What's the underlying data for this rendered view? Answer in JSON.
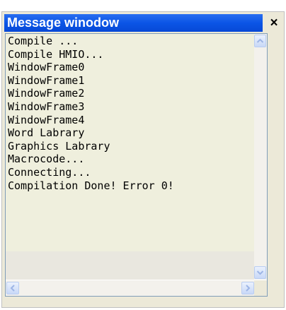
{
  "window": {
    "title": "Message winodow",
    "close_label": "×"
  },
  "messages": [
    "Compile ...",
    "Compile HMIO...",
    "WindowFrame0",
    "WindowFrame1",
    "WindowFrame2",
    "WindowFrame3",
    "WindowFrame4",
    "Word Labrary",
    "Graphics Labrary",
    "Macrocode...",
    "Connecting...",
    "Compilation Done! Error 0!"
  ],
  "icons": {
    "close": "close-icon",
    "scroll_up": "chevron-up-icon",
    "scroll_down": "chevron-down-icon",
    "scroll_left": "chevron-left-icon",
    "scroll_right": "chevron-right-icon"
  },
  "colors": {
    "title_bar": "#0b55e6",
    "title_text": "#ffffff",
    "list_bg": "#efefdd",
    "scroll_button": "#c8d8f7"
  }
}
